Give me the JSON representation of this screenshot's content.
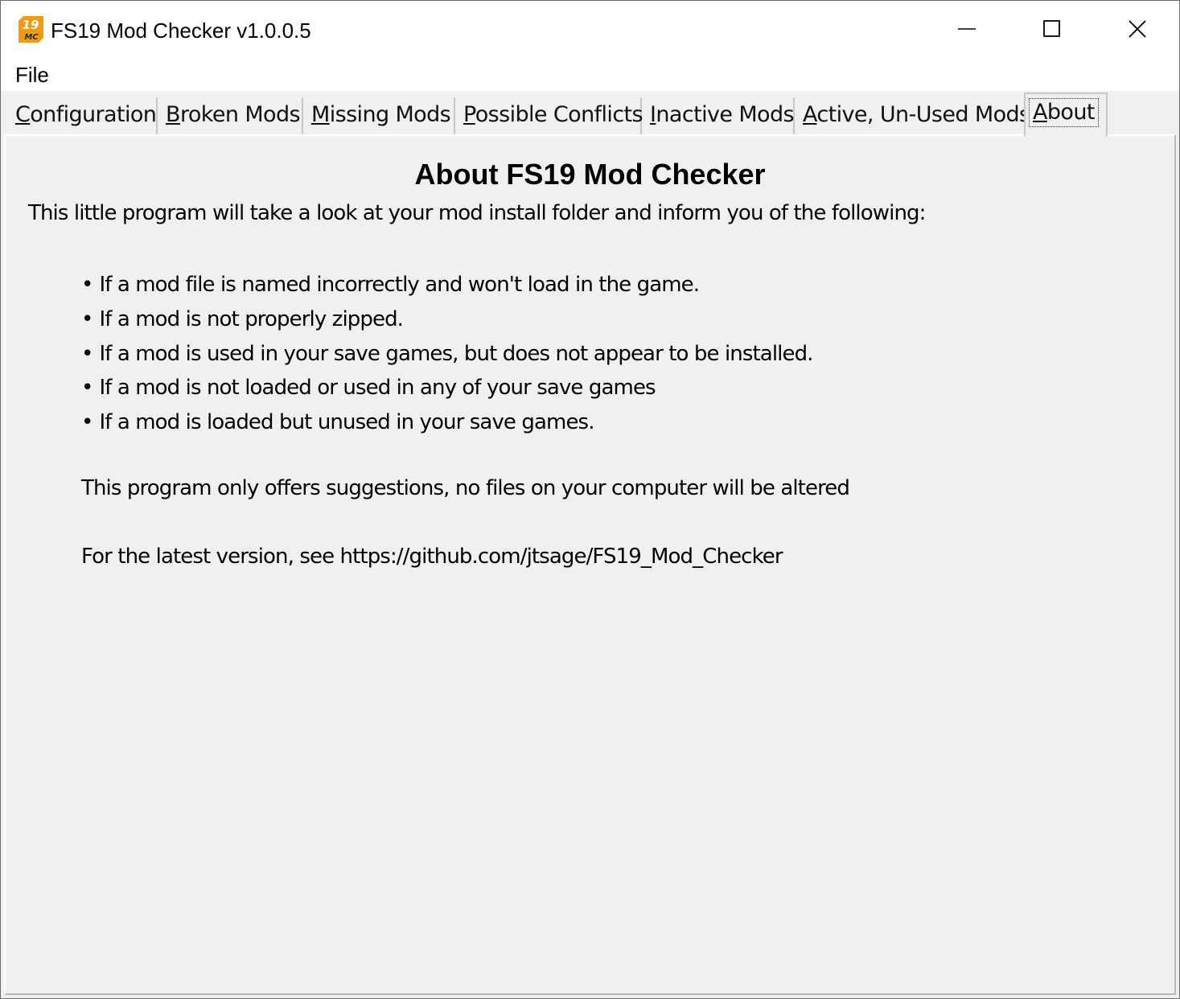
{
  "window": {
    "title": "FS19 Mod Checker v1.0.0.5",
    "icon": "fs19-mod-checker-app-icon",
    "icon_text_top": "19",
    "icon_text_bottom": "MC",
    "accent_color": "#f39a13"
  },
  "menu": {
    "items": [
      {
        "label": "File"
      }
    ]
  },
  "tabs": [
    {
      "label_ul": "C",
      "label_rest": "onfiguration",
      "active": false
    },
    {
      "label_ul": "B",
      "label_rest": "roken Mods",
      "active": false
    },
    {
      "label_ul": "M",
      "label_rest": "issing Mods",
      "active": false
    },
    {
      "label_ul": "P",
      "label_rest": "ossible Conflicts",
      "active": false
    },
    {
      "label_ul": "I",
      "label_rest": "nactive Mods",
      "active": false
    },
    {
      "label_ul": "A",
      "label_rest": "ctive, Un-Used Mods",
      "active": false
    },
    {
      "label_ul": "A",
      "label_rest": "bout",
      "active": true
    }
  ],
  "about": {
    "heading": "About FS19 Mod Checker",
    "intro": "This little program will take a look at your mod install folder and inform you of the following:",
    "bullets": [
      "If a mod file is named incorrectly and won't load in the game.",
      "If a mod is not properly zipped.",
      "If a mod is used in your save games, but does not appear to be installed.",
      "If a mod is not loaded or used in any of your save games",
      "If a mod is loaded but unused in your save games."
    ],
    "note": "This program only offers suggestions, no files on your computer will be altered",
    "link_line": "For the latest version, see https://github.com/jtsage/FS19_Mod_Checker"
  }
}
